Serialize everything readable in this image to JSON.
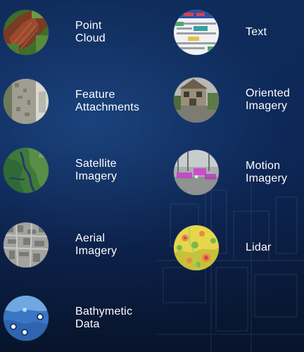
{
  "items": [
    {
      "id": "point-cloud",
      "lines": [
        "Point",
        "Cloud"
      ],
      "icon": "point-cloud-thumbnail"
    },
    {
      "id": "feature-attachments",
      "lines": [
        "Feature",
        "Attachments"
      ],
      "icon": "feature-attachments-thumbnail"
    },
    {
      "id": "satellite-imagery",
      "lines": [
        "Satellite",
        "Imagery"
      ],
      "icon": "satellite-imagery-thumbnail"
    },
    {
      "id": "aerial-imagery",
      "lines": [
        "Aerial",
        "Imagery"
      ],
      "icon": "aerial-imagery-thumbnail"
    },
    {
      "id": "bathymetic-data",
      "lines": [
        "Bathymetic",
        "Data"
      ],
      "icon": "bathymetric-data-thumbnail"
    },
    {
      "id": "text",
      "lines": [
        "Text"
      ],
      "icon": "text-thumbnail"
    },
    {
      "id": "oriented-imagery",
      "lines": [
        "Oriented",
        "Imagery"
      ],
      "icon": "oriented-imagery-thumbnail"
    },
    {
      "id": "motion-imagery",
      "lines": [
        "Motion",
        "Imagery"
      ],
      "icon": "motion-imagery-thumbnail"
    },
    {
      "id": "lidar",
      "lines": [
        "Lidar"
      ],
      "icon": "lidar-thumbnail"
    }
  ],
  "colors": {
    "background_top": "#0d2a55",
    "background_bottom": "#07142c",
    "text": "#ffffff"
  }
}
